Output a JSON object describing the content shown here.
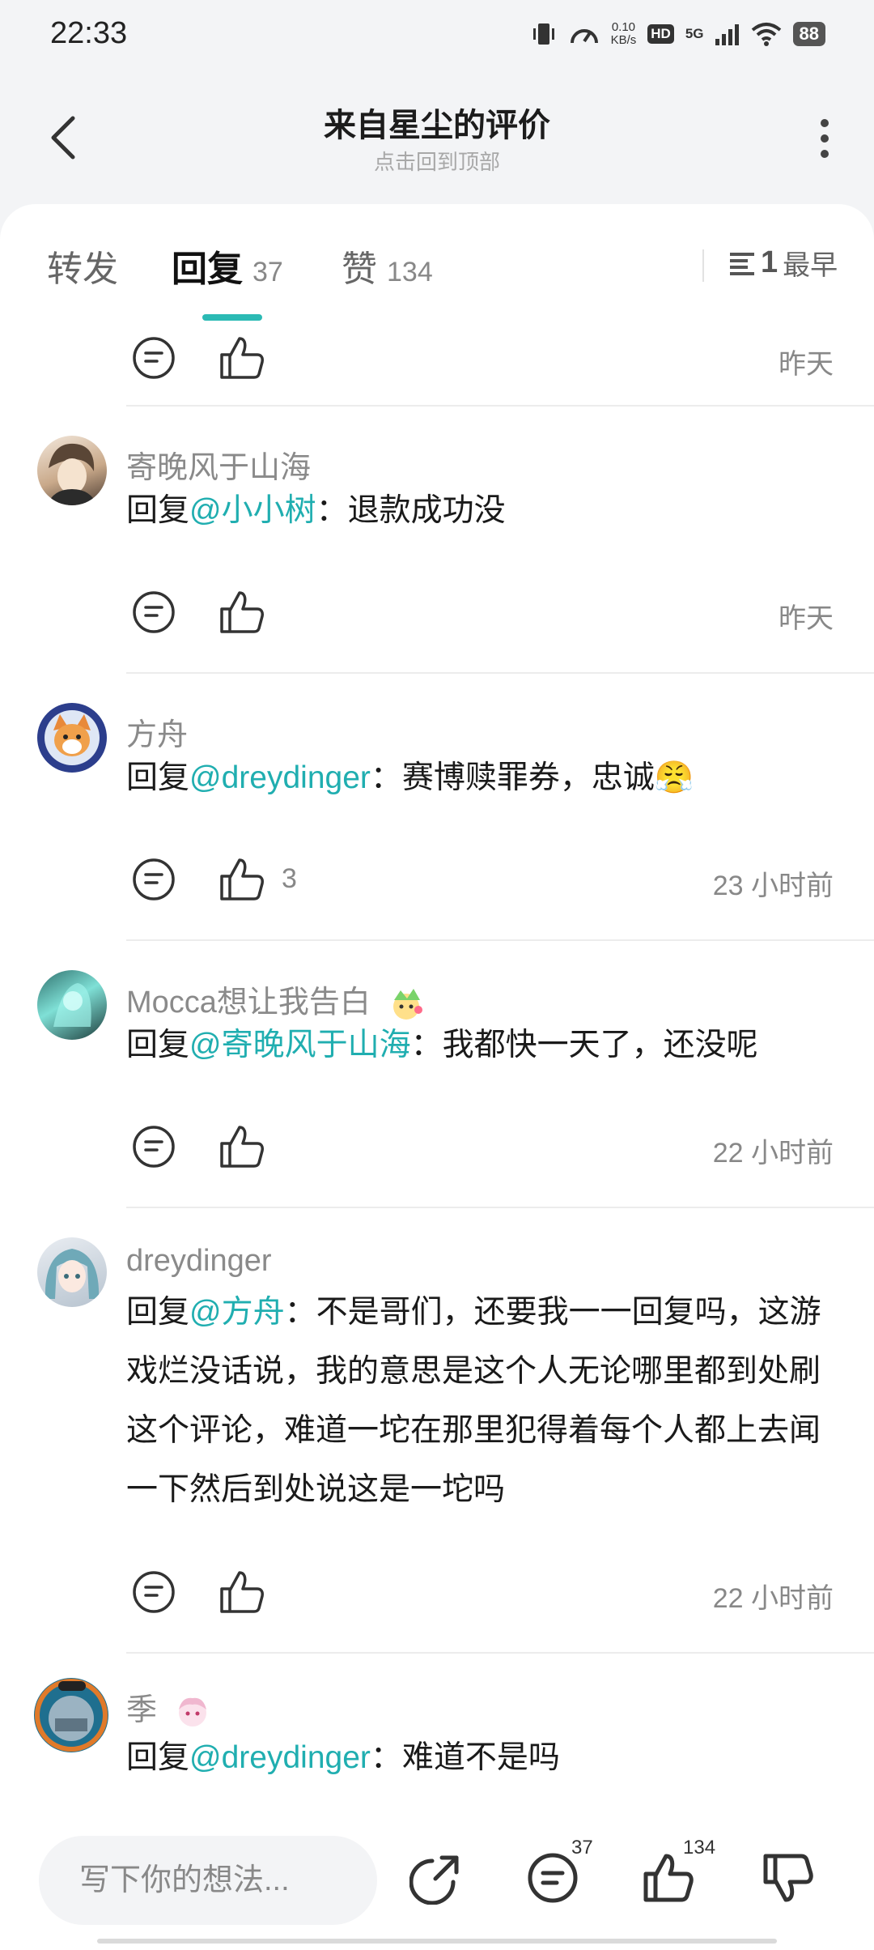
{
  "status_bar": {
    "time": "22:33",
    "net_speed_value": "0.10",
    "net_speed_unit": "KB/s",
    "hd": "HD",
    "network": "5G",
    "battery": "88"
  },
  "header": {
    "title": "来自星尘的评价",
    "subtitle": "点击回到顶部"
  },
  "tabs": {
    "forward_label": "转发",
    "reply_label": "回复",
    "reply_count": "37",
    "like_label": "赞",
    "like_count": "134",
    "sort_number": "1",
    "sort_label": "最早"
  },
  "colors": {
    "accent": "#2bbab4",
    "mention": "#20aeb0"
  },
  "comments": [
    {
      "time": "昨天"
    },
    {
      "user": "寄晚风于山海",
      "reply_prefix": "回复",
      "mention": "@小小树",
      "body": "：退款成功没",
      "time": "昨天"
    },
    {
      "user": "方舟",
      "reply_prefix": "回复",
      "mention": "@dreydinger",
      "body": "：赛博赎罪券，忠诚😤",
      "likes": "3",
      "time": "23 小时前"
    },
    {
      "user": "Mocca想让我告白",
      "reply_prefix": "回复",
      "mention": "@寄晚风于山海",
      "body": "：我都快一天了，还没呢",
      "time": "22 小时前"
    },
    {
      "user": "dreydinger",
      "reply_prefix": "回复",
      "mention": "@方舟",
      "body": "：不是哥们，还要我一一回复吗，这游戏烂没话说，我的意思是这个人无论哪里都到处刷这个评论，难道一坨在那里犯得着每个人都上去闻一下然后到处说这是一坨吗",
      "time": "22 小时前"
    },
    {
      "user": "季",
      "reply_prefix": "回复",
      "mention": "@dreydinger",
      "body": "：难道不是吗"
    }
  ],
  "bottom_bar": {
    "input_placeholder": "写下你的想法...",
    "comment_count": "37",
    "like_count": "134"
  }
}
